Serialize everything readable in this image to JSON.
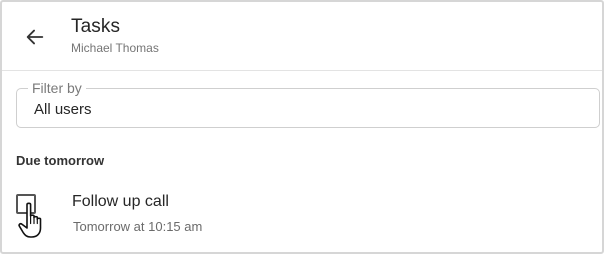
{
  "header": {
    "back_icon": "arrow-left-icon",
    "title": "Tasks",
    "subtitle": "Michael Thomas"
  },
  "filter": {
    "label": "Filter by",
    "value": "All users"
  },
  "sections": [
    {
      "heading": "Due tomorrow",
      "tasks": [
        {
          "title": "Follow up call",
          "due": "Tomorrow at 10:15 am",
          "completed": false
        }
      ]
    }
  ],
  "cursor_icon": "hand-pointer-icon"
}
